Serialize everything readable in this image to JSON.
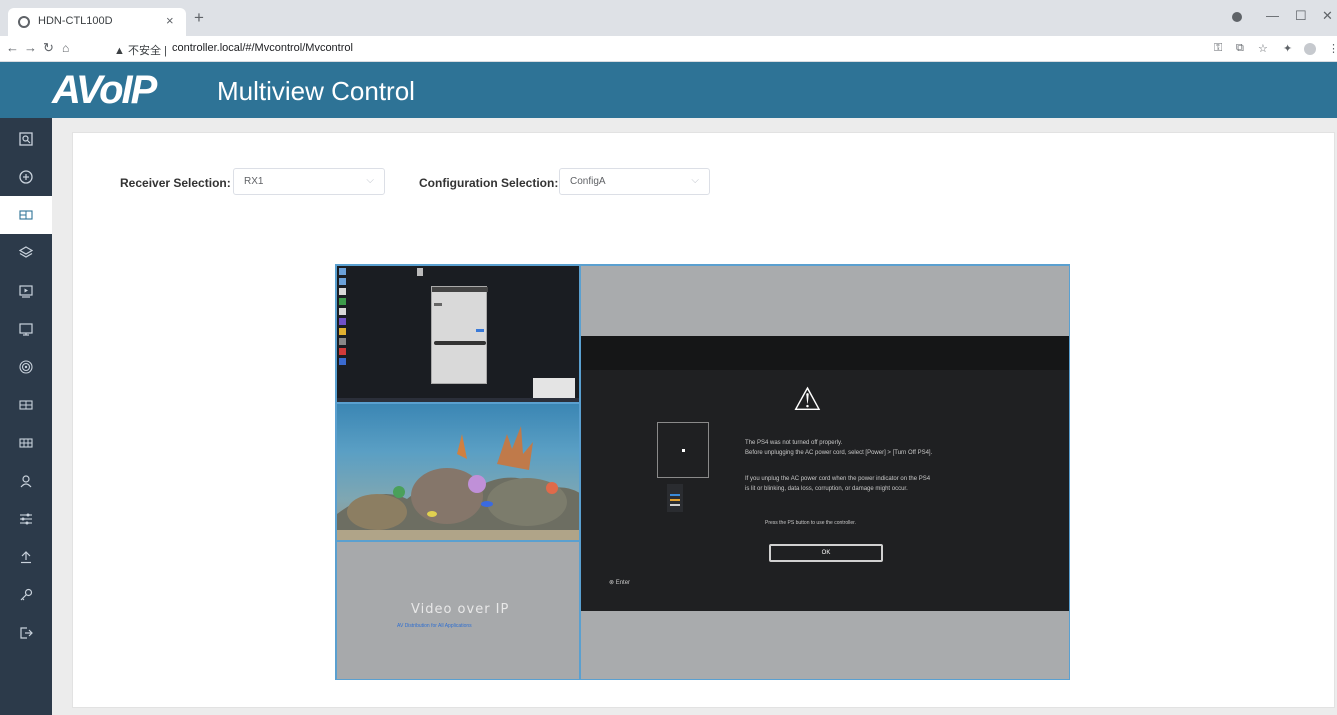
{
  "browser": {
    "tab_title": "HDN-CTL100D",
    "tab_close": "×",
    "new_tab": "+",
    "url_warning": "▲ 不安全 |",
    "url": "controller.local/#/Mvcontrol/Mvcontrol",
    "window_controls": [
      "—",
      "☐",
      "✕"
    ]
  },
  "header": {
    "logo": "AVoIP",
    "title": "Multiview Control",
    "background": "#2e7396"
  },
  "sidebar": {
    "items": [
      {
        "icon": "search-view-icon"
      },
      {
        "icon": "plus-circle-icon"
      },
      {
        "icon": "multiview-icon",
        "active": true
      },
      {
        "icon": "layers-icon"
      },
      {
        "icon": "video-source-icon"
      },
      {
        "icon": "display-icon"
      },
      {
        "icon": "signal-icon"
      },
      {
        "icon": "videowall-icon"
      },
      {
        "icon": "grid-icon"
      },
      {
        "icon": "user-icon"
      },
      {
        "icon": "settings-sliders-icon"
      },
      {
        "icon": "upgrade-icon"
      },
      {
        "icon": "key-icon"
      },
      {
        "icon": "logout-icon"
      }
    ]
  },
  "form": {
    "receiver_label": "Receiver Selection:",
    "receiver_value": "RX1",
    "config_label": "Configuration Selection:",
    "config_value": "ConfigA",
    "arrow": "⌵"
  },
  "preview": {
    "ps4": {
      "warning_symbol": "⚠",
      "line1": "The PS4 was not turned off properly.",
      "line2": "Before unplugging the AC power cord, select [Power] > [Turn Off PS4].",
      "line3": "If you unplug the AC power cord when the power indicator on the PS4",
      "line4": "is lit or blinking, data loss, corruption, or damage might occur.",
      "line5": "Press the PS button to use the controller.",
      "ok": "OK",
      "enter": "⊗ Enter"
    },
    "vop": {
      "title": "Video over IP",
      "subtitle": "AV Distribution for All Applications"
    }
  }
}
